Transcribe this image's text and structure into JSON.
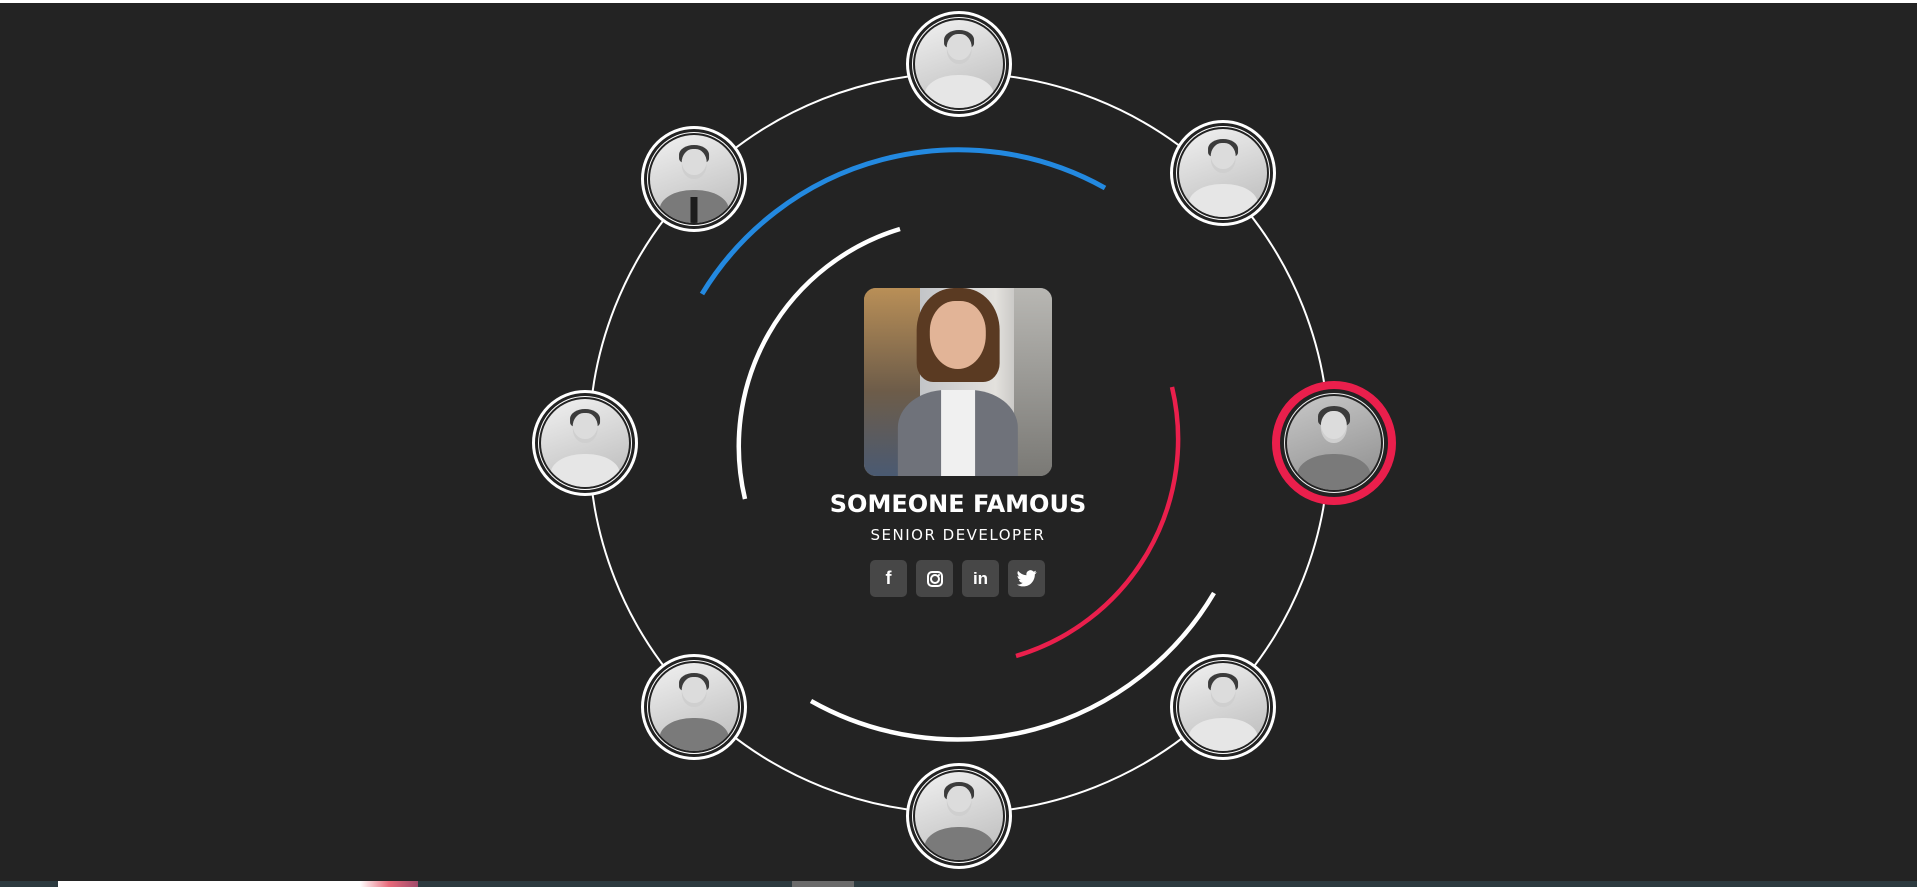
{
  "profile": {
    "name": "SOMEONE FAMOUS",
    "title": "SENIOR DEVELOPER"
  },
  "socials": [
    {
      "icon": "facebook-icon",
      "glyph": "f"
    },
    {
      "icon": "instagram-icon",
      "glyph": ""
    },
    {
      "icon": "linkedin-icon",
      "glyph": "in"
    },
    {
      "icon": "twitter-icon",
      "glyph": "🐦"
    }
  ],
  "team_avatars": [
    {
      "position": "top",
      "active": false
    },
    {
      "position": "top-right",
      "active": false
    },
    {
      "position": "right",
      "active": true
    },
    {
      "position": "bottom-right",
      "active": false
    },
    {
      "position": "bottom",
      "active": false
    },
    {
      "position": "bottom-left",
      "active": false
    },
    {
      "position": "left",
      "active": false
    },
    {
      "position": "top-left",
      "active": false
    }
  ],
  "colors": {
    "background": "#232323",
    "accent_blue": "#2389e0",
    "accent_red": "#ea1f4c",
    "ring": "#ffffff",
    "social_bg": "#474747"
  }
}
